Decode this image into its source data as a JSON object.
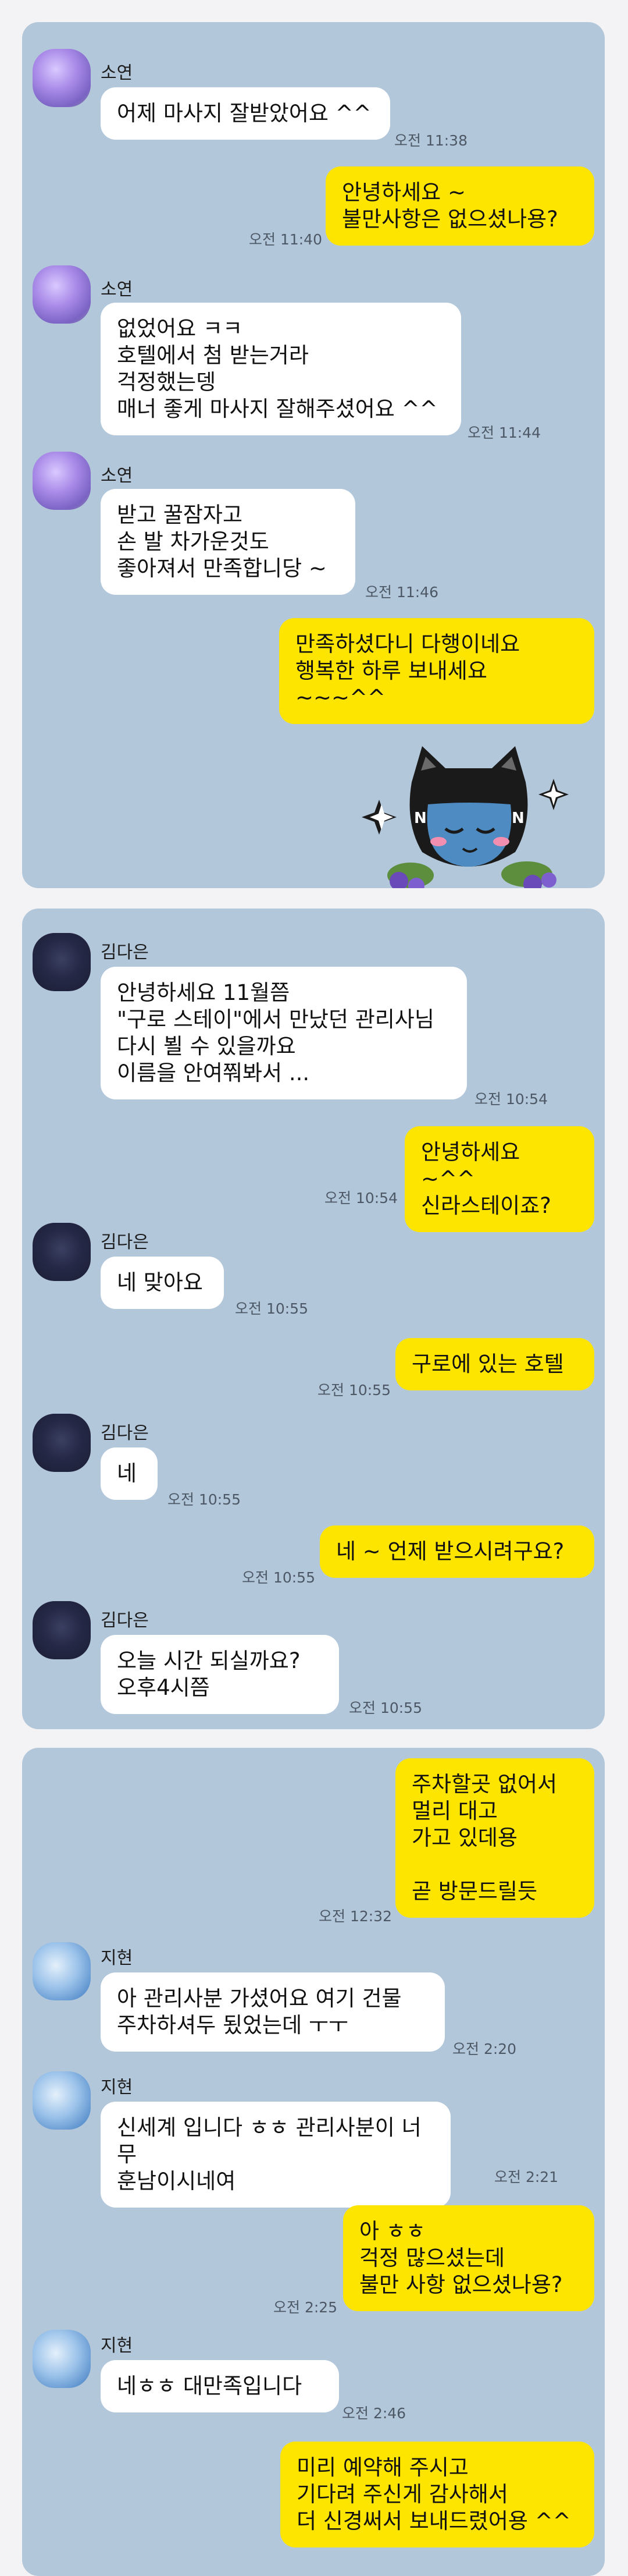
{
  "colors": {
    "chat_bg": "#b3c7da",
    "outgoing": "#fee500",
    "incoming": "#ffffff",
    "page_bg": "#f3f3f5"
  },
  "panels": [
    {
      "messages": [
        {
          "sender": "소연",
          "text": "어제 마사지 잘받았어요 ^^",
          "time": "오전 11:38"
        },
        {
          "text": "안녕하세요 ~\n불만사항은 없으셨나용?",
          "time": "오전 11:40"
        },
        {
          "sender": "소연",
          "text": "없었어요 ㅋㅋ\n호텔에서 첨 받는거라\n걱정했는뎅\n매너 좋게 마사지 잘해주셨어요 ^^",
          "time": "오전 11:44"
        },
        {
          "sender": "소연",
          "text": "받고 꿀잠자고\n손 발 차가운것도\n좋아져서 만족합니당 ~",
          "time": "오전 11:46"
        },
        {
          "text": "만족하셨다니 다행이네요\n행복한 하루 보내세요 ~~~^^"
        }
      ],
      "sticker": "cat-sticker-icon"
    },
    {
      "messages": [
        {
          "sender": "김다은",
          "text": "안녕하세요 11월쯤\n\"구로 스테이\"에서 만났던 관리사님\n다시 뵐 수 있을까요\n이름을 안여쭤봐서 ...",
          "time": "오전 10:54"
        },
        {
          "text": "안녕하세요 ~^^\n신라스테이죠?",
          "time": "오전 10:54"
        },
        {
          "sender": "김다은",
          "text": "네 맞아요",
          "time": "오전 10:55"
        },
        {
          "text": "구로에 있는 호텔",
          "time": "오전 10:55"
        },
        {
          "sender": "김다은",
          "text": "네",
          "time": "오전 10:55"
        },
        {
          "text": "네 ~ 언제 받으시려구요?",
          "time": "오전 10:55"
        },
        {
          "sender": "김다은",
          "text": "오늘  시간 되실까요?\n오후4시쯤",
          "time": "오전 10:55"
        }
      ]
    },
    {
      "messages": [
        {
          "text": "주차할곳 없어서\n멀리 대고\n가고 있데용\n\n곧 방문드릴듯",
          "time": "오전 12:32"
        },
        {
          "sender": "지현",
          "text": "아 관리사분 가셨어요 여기 건물\n주차하셔두 됬었는데 ㅜㅜ",
          "time": "오전 2:20"
        },
        {
          "sender": "지현",
          "text": "신세계 입니다 ㅎㅎ 관리사분이 너무\n훈남이시네여",
          "time": "오전 2:21"
        },
        {
          "text": "아 ㅎㅎ\n걱정 많으셨는데\n불만 사항 없으셨나용?",
          "time": "오전 2:25"
        },
        {
          "sender": "지현",
          "text": "네ㅎㅎ 대만족입니다",
          "time": "오전 2:46"
        },
        {
          "text": "미리 예약해 주시고\n기다려 주신게 감사해서\n더 신경써서 보내드렸어용 ^^"
        }
      ]
    }
  ]
}
